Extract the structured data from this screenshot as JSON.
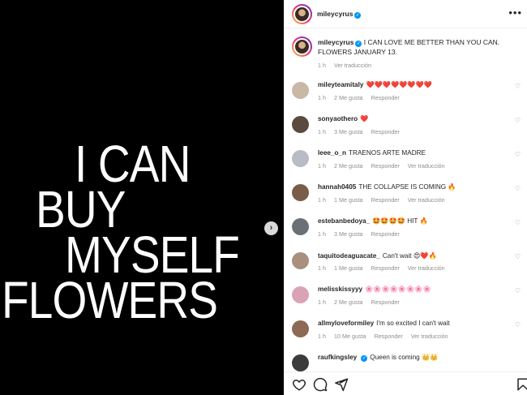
{
  "poster": {
    "lines": [
      "I CAN",
      "BUY",
      "MYSELF",
      "FLOWERS"
    ]
  },
  "header": {
    "username": "mileycyrus"
  },
  "caption": {
    "username": "mileycyrus",
    "text": "I CAN LOVE ME BETTER THAN YOU CAN. FLOWERS JANUARY 13.",
    "time": "1 h",
    "translate": "Ver traducción"
  },
  "comments": [
    {
      "user": "mileyteamitaly",
      "text": "❤️❤️❤️❤️❤️❤️❤️❤️",
      "time": "1 h",
      "likes": "2 Me gusta",
      "reply": "Responder",
      "translate": ""
    },
    {
      "user": "sonyaothero",
      "text": "❤️",
      "time": "1 h",
      "likes": "3 Me gusta",
      "reply": "Responder",
      "translate": ""
    },
    {
      "user": "leee_o_n",
      "text": "TRAENOS ARTE MADRE",
      "time": "1 h",
      "likes": "2 Me gusta",
      "reply": "Responder",
      "translate": "Ver traducción"
    },
    {
      "user": "hannah0405",
      "text": "THE COLLAPSE IS COMING 🔥",
      "time": "1 h",
      "likes": "1 Me gusta",
      "reply": "Responder",
      "translate": "Ver traducción"
    },
    {
      "user": "estebanbedoya_",
      "text": "🤩🤩🤩🤩 HIT 🔥",
      "time": "1 h",
      "likes": "3 Me gusta",
      "reply": "Responder",
      "translate": ""
    },
    {
      "user": "taquitodeaguacate_",
      "text": "Can't wait 😍❤️🔥",
      "time": "1 h",
      "likes": "1 Me gusta",
      "reply": "Responder",
      "translate": "Ver traducción"
    },
    {
      "user": "melisskissyyy",
      "text": "🌸🌸🌸🌸🌸🌸🌸🌸",
      "time": "1 h",
      "likes": "2 Me gusta",
      "reply": "Responder",
      "translate": ""
    },
    {
      "user": "allmyloveformiley",
      "text": "I'm so excited I can't wait",
      "time": "1 h",
      "likes": "10 Me gusta",
      "reply": "Responder",
      "translate": "Ver traducción"
    },
    {
      "user": "raufkingsley",
      "text": "Queen is coming 👑👑",
      "time": "",
      "likes": "",
      "reply": "",
      "translate": ""
    }
  ],
  "icons": {
    "like": "heart-icon",
    "comment": "comment-icon",
    "share": "share-icon",
    "save": "bookmark-icon",
    "next": "chevron-right-icon",
    "more": "more-icon",
    "verified": "verified-badge-icon"
  },
  "colors": {
    "accent": "#0095f6",
    "heart": "#ed4956",
    "muted": "#8e8e8e"
  }
}
